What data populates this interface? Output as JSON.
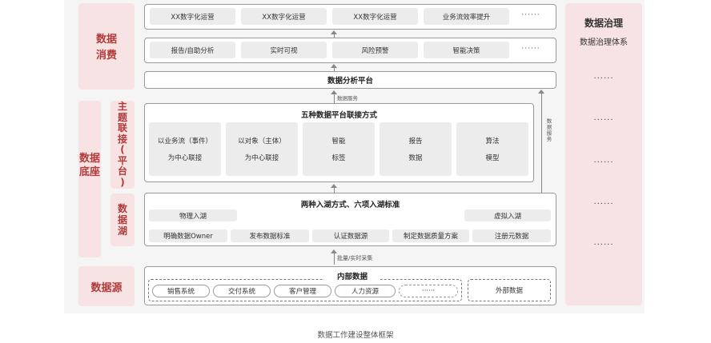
{
  "left": {
    "consume": "数据\n消费",
    "base": "数据\n底座",
    "source": "数据源",
    "topic": "主\n题\n联\n接\n(\n平\n台\n)",
    "lake": "数\n据\n湖"
  },
  "row1": [
    "XX数字化运营",
    "XX数字化运营",
    "XX数字化运营",
    "业务流效率提升",
    "······"
  ],
  "row2": [
    "报告/自助分析",
    "实时可视",
    "风险预警",
    "智能决策",
    "······"
  ],
  "platform": "数据分析平台",
  "service_label": "数据服务",
  "five": {
    "title": "五种数据平台联接方式",
    "cells": [
      {
        "l1": "以业务流（事件）",
        "l2": "为中心联接"
      },
      {
        "l1": "以对象（主体）",
        "l2": "为中心联接"
      },
      {
        "l1": "智能",
        "l2": "标签"
      },
      {
        "l1": "报告",
        "l2": "数据"
      },
      {
        "l1": "算法",
        "l2": "模型"
      }
    ]
  },
  "side_service_label": "数据服务",
  "lake": {
    "title": "两种入湖方式、六项入湖标准",
    "physical": "物理入湖",
    "virtual": "虚拟入湖",
    "standards": [
      "明确数据Owner",
      "发布数据标准",
      "认证数据源",
      "制定数据质量方案",
      "注册元数据"
    ]
  },
  "collect_label": "批量/实时采集",
  "sources": {
    "internal_title": "内部数据",
    "internal": [
      "销售系统",
      "交付系统",
      "客户管理",
      "人力资源",
      "······"
    ],
    "external": "外部数据"
  },
  "governance": {
    "title": "数据治理",
    "subtitle": "数据治理体系",
    "dots": [
      "······",
      "······",
      "······",
      "······",
      "······"
    ]
  },
  "caption": "数据工作建设整体框架"
}
